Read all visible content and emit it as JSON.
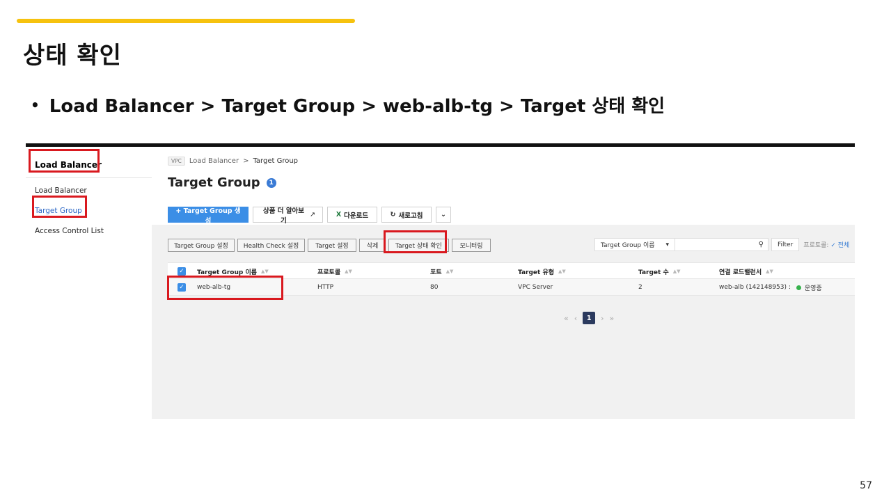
{
  "slide": {
    "title": "상태 확인",
    "bullet": "Load Balancer > Target Group > web-alb-tg > Target 상태 확인",
    "page_number": "57",
    "accent_color": "#f6c20e",
    "highlight_color": "#d9191f"
  },
  "sidebar": {
    "title": "Load Balancer",
    "items": [
      {
        "label": "Load Balancer",
        "active": false
      },
      {
        "label": "Target Group",
        "active": true
      },
      {
        "label": "Access Control List",
        "active": false
      }
    ]
  },
  "breadcrumb": {
    "tag": "VPC",
    "items": [
      "Load Balancer",
      "Target Group"
    ],
    "separator": ">"
  },
  "page": {
    "title": "Target Group",
    "info_badge": "1"
  },
  "toolbar": {
    "create": "+ Target Group 생성",
    "learn_more": "상품 더 알아보기",
    "download": "다운로드",
    "refresh": "새로고침",
    "more_icon": "chevron-down-icon"
  },
  "actions": [
    "Target Group 설정",
    "Health Check 설정",
    "Target 설정",
    "삭제",
    "Target 상태 확인",
    "모니터링"
  ],
  "search": {
    "select_value": "Target Group 이름",
    "filter_label": "Filter",
    "protocol_label": "프로토콜:",
    "protocol_value": "전체"
  },
  "table": {
    "columns": [
      "Target Group 이름",
      "프로토콜",
      "포트",
      "Target 유형",
      "Target 수",
      "연결 로드밸런서"
    ],
    "rows": [
      {
        "checked": true,
        "name": "web-alb-tg",
        "protocol": "HTTP",
        "port": "80",
        "target_type": "VPC Server",
        "target_count": "2",
        "load_balancer": "web-alb (142148953) :",
        "status": "운영중",
        "status_color": "#37b24d"
      }
    ]
  },
  "pagination": {
    "current": "1"
  }
}
